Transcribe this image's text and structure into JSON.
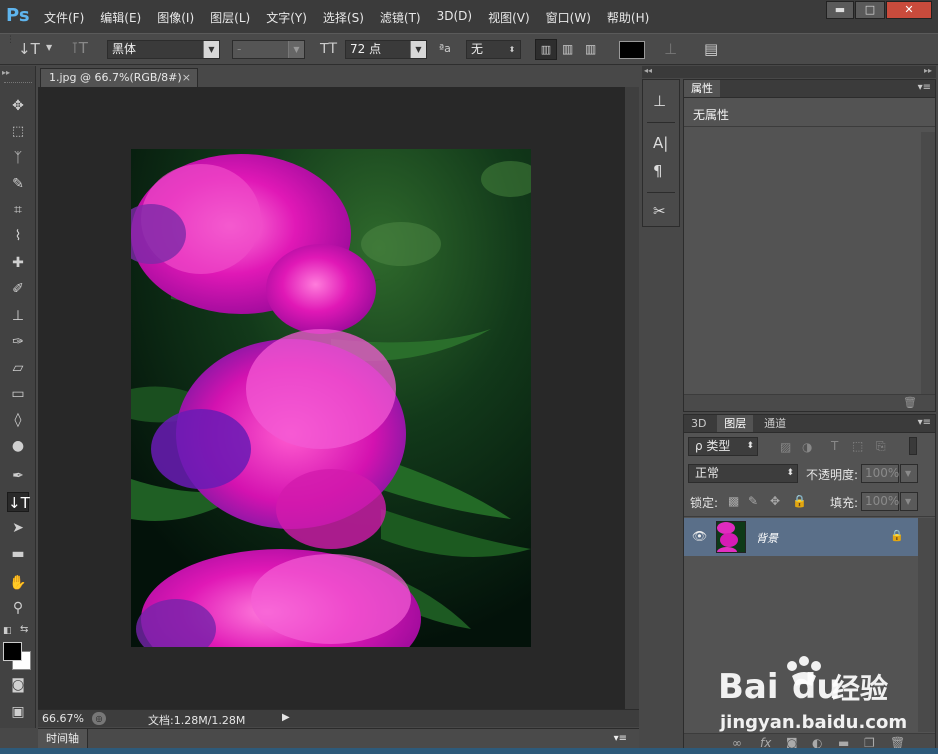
{
  "app": {
    "logo": "Ps"
  },
  "menu": [
    "文件(F)",
    "编辑(E)",
    "图像(I)",
    "图层(L)",
    "文字(Y)",
    "选择(S)",
    "滤镜(T)",
    "3D(D)",
    "视图(V)",
    "窗口(W)",
    "帮助(H)"
  ],
  "window_controls": {
    "minimize": "▬",
    "maximize": "□",
    "close": "✕"
  },
  "options": {
    "font_family": "黑体",
    "font_style": "-",
    "font_size": "72 点",
    "antialias_label": "ªa",
    "antialias": "无",
    "text_color": "#000000"
  },
  "document": {
    "tab_title": "1.jpg @ 66.7%(RGB/8#)",
    "tab_close": "×",
    "zoom": "66.67%",
    "doc_size": "文档:1.28M/1.28M"
  },
  "timeline": {
    "label": "时间轴"
  },
  "properties": {
    "tab": "属性",
    "content": "无属性"
  },
  "layers": {
    "tabs": [
      "3D",
      "图层",
      "通道"
    ],
    "filter_kind": "ρ 类型",
    "blend_mode": "正常",
    "opacity_label": "不透明度:",
    "opacity_value": "100%",
    "lock_label": "锁定:",
    "fill_label": "填充:",
    "fill_value": "100%",
    "layer_name": "背景",
    "footer_icons": [
      "link-icon",
      "fx-icon",
      "mask-icon",
      "adjustment-icon",
      "folder-icon",
      "new-layer-icon",
      "trash-icon"
    ]
  },
  "watermark": {
    "brand": "Bai",
    "brand2": "du",
    "brand_cn": "经验",
    "url": "jingyan.baidu.com"
  },
  "colors": {
    "accent_blue": "#5fb5ee",
    "selected_layer": "#5a6f89",
    "foreground": "#000000",
    "background": "#ffffff"
  }
}
